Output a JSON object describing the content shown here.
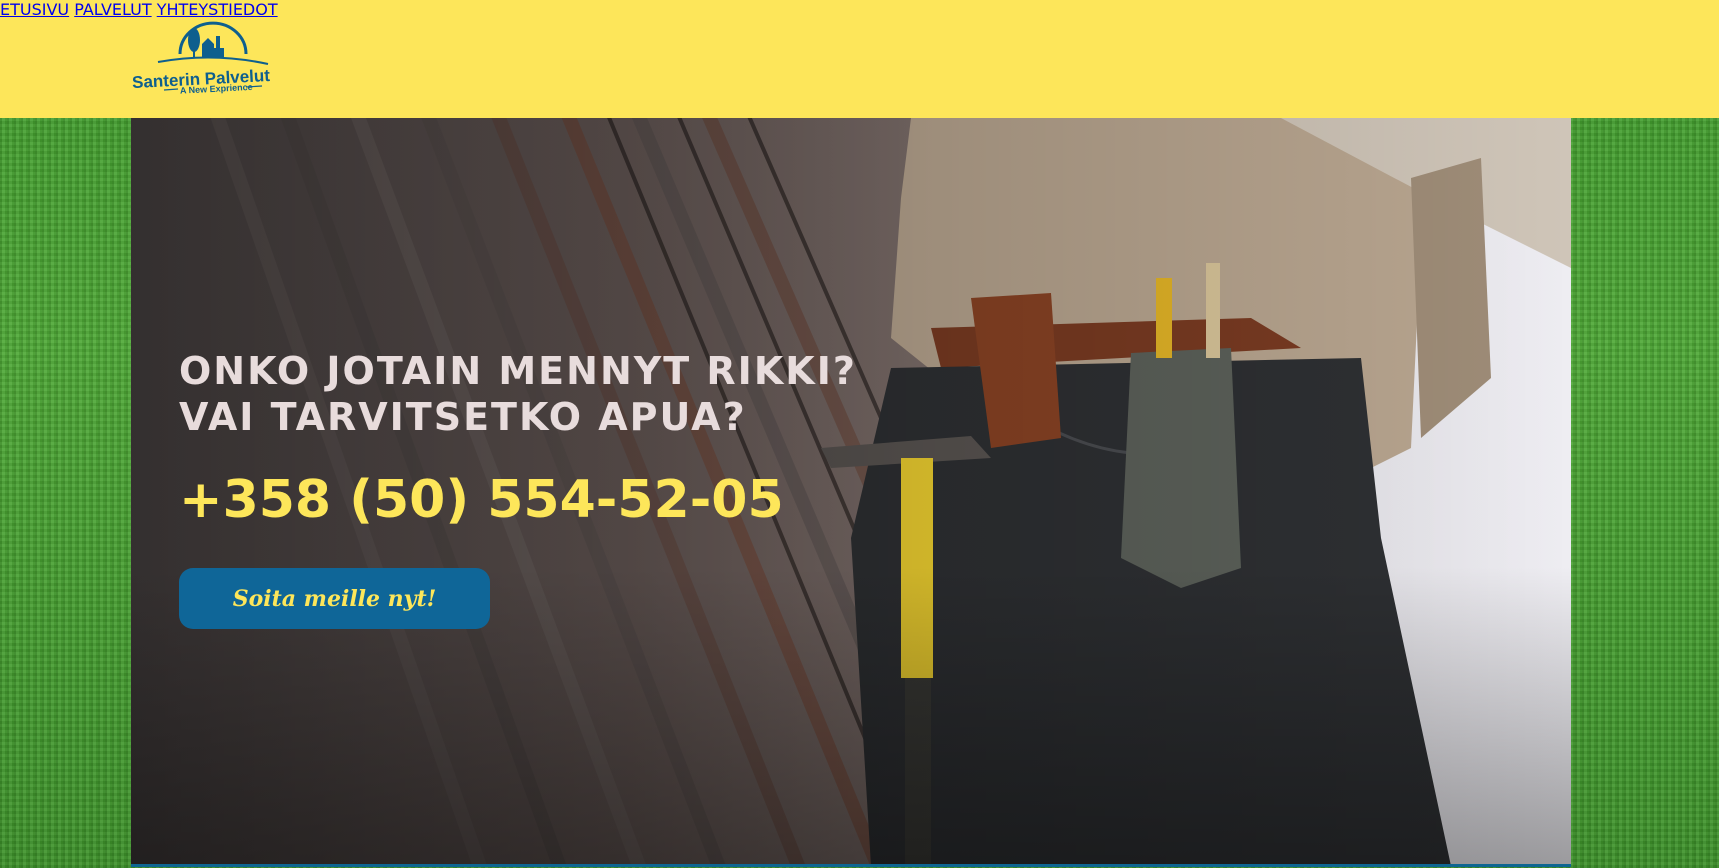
{
  "header": {
    "logo": {
      "name": "Santerin Palvelut",
      "tagline": "A New Exprience"
    },
    "nav": [
      {
        "label": "ETUSIVU"
      },
      {
        "label": "PALVELUT"
      },
      {
        "label": "YHTEYSTIEDOT"
      }
    ]
  },
  "hero": {
    "headline_line1": "ONKO JOTAIN MENNYT RIKKI?",
    "headline_line2": "VAI TARVITSETKO APUA?",
    "phone": "+358 (50) 554-52-05",
    "cta_label": "Soita meille nyt!",
    "image": "worker-with-tool-belt-and-hammer"
  },
  "colors": {
    "header_bg": "#fde65a",
    "nav_text": "#0d6b8c",
    "accent_yellow": "#fde65a",
    "cta_bg": "#0f6698",
    "background": "grass-green"
  }
}
